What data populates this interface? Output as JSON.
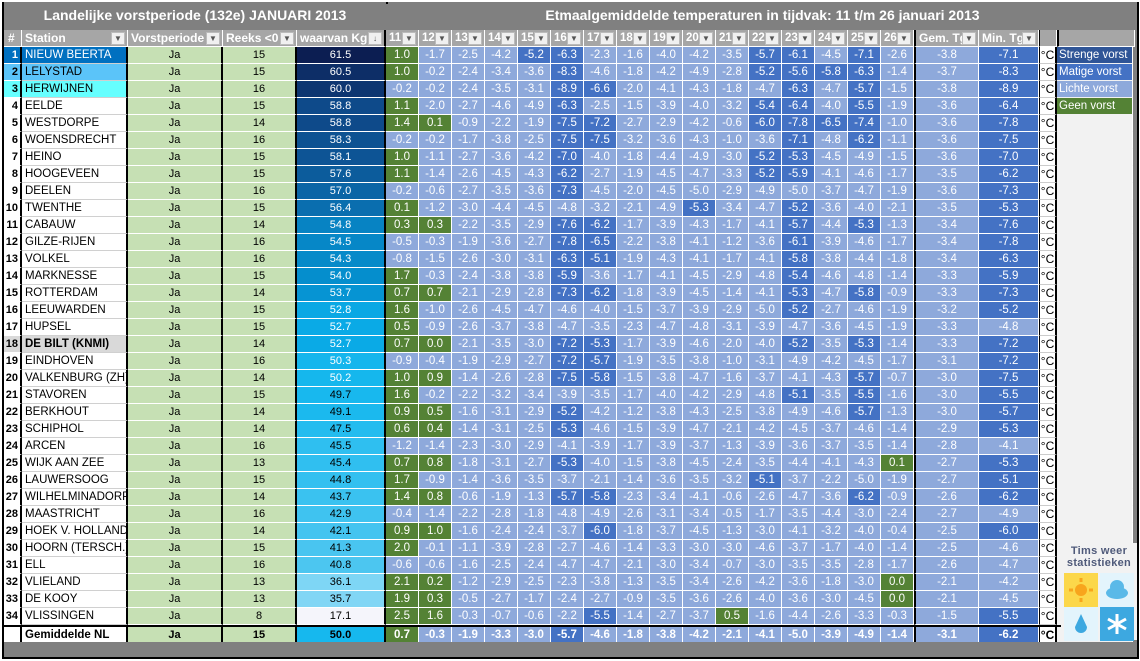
{
  "titles": {
    "left": "Landelijke vorstperiode (132e) JANUARI 2013",
    "right": "Etmaalgemiddelde temperaturen in tijdvak: 11 t/m 26 januari 2013"
  },
  "headers": {
    "num": "#",
    "station": "Station",
    "vorstperiode": "Vorstperiode",
    "reeks": "Reeks <0",
    "kg": "waarvan Kg",
    "days": [
      "11",
      "12",
      "13",
      "14",
      "15",
      "16",
      "17",
      "18",
      "19",
      "20",
      "21",
      "22",
      "23",
      "24",
      "25",
      "26"
    ],
    "gem": "Gem. Tg",
    "min": "Min. Tg"
  },
  "unit": "°C",
  "legend": [
    {
      "label": "Strenge vorst",
      "color": "#2f5597"
    },
    {
      "label": "Matige vorst",
      "color": "#4472c4"
    },
    {
      "label": "Lichte vorst",
      "color": "#8ea9db"
    },
    {
      "label": "Geen vorst",
      "color": "#548235"
    }
  ],
  "logo": {
    "text": "Tims weer statistieken"
  },
  "colors": {
    "light": "#8ea9db",
    "matige": "#4472c4",
    "geen": "#548235"
  },
  "rows": [
    {
      "n": "1",
      "station": "NIEUW BEERTA",
      "vp": "Ja",
      "reeks": "15",
      "kg": "61.5",
      "t": [
        "1.0",
        "-1.7",
        "-2.5",
        "-4.2",
        "-5.2",
        "-6.3",
        "-2.3",
        "-1.6",
        "-4.0",
        "-4.2",
        "-3.5",
        "-5.7",
        "-6.1",
        "-4.5",
        "-7.1",
        "-2.6"
      ],
      "gem": "-3.8",
      "min": "-7.1"
    },
    {
      "n": "2",
      "station": "LELYSTAD",
      "vp": "Ja",
      "reeks": "15",
      "kg": "60.5",
      "t": [
        "1.0",
        "-0.2",
        "-2.4",
        "-3.4",
        "-3.6",
        "-8.3",
        "-4.6",
        "-1.8",
        "-4.2",
        "-4.9",
        "-2.8",
        "-5.2",
        "-5.6",
        "-5.8",
        "-6.3",
        "-1.4"
      ],
      "gem": "-3.7",
      "min": "-8.3"
    },
    {
      "n": "3",
      "station": "HERWIJNEN",
      "vp": "Ja",
      "reeks": "16",
      "kg": "60.0",
      "t": [
        "-0.2",
        "-0.2",
        "-2.4",
        "-3.5",
        "-3.1",
        "-8.9",
        "-6.6",
        "-2.0",
        "-4.1",
        "-4.3",
        "-1.8",
        "-4.7",
        "-6.3",
        "-4.7",
        "-5.7",
        "-1.5"
      ],
      "gem": "-3.8",
      "min": "-8.9"
    },
    {
      "n": "4",
      "station": "EELDE",
      "vp": "Ja",
      "reeks": "15",
      "kg": "58.8",
      "t": [
        "1.1",
        "-2.0",
        "-2.7",
        "-4.6",
        "-4.9",
        "-6.3",
        "-2.5",
        "-1.5",
        "-3.9",
        "-4.0",
        "-3.2",
        "-5.4",
        "-6.4",
        "-4.0",
        "-5.5",
        "-1.9"
      ],
      "gem": "-3.6",
      "min": "-6.4"
    },
    {
      "n": "5",
      "station": "WESTDORPE",
      "vp": "Ja",
      "reeks": "14",
      "kg": "58.8",
      "t": [
        "1.4",
        "0.1",
        "-0.9",
        "-2.2",
        "-1.9",
        "-7.5",
        "-7.2",
        "-2.7",
        "-2.9",
        "-4.2",
        "-0.6",
        "-6.0",
        "-7.8",
        "-6.5",
        "-7.4",
        "-1.0"
      ],
      "gem": "-3.6",
      "min": "-7.8"
    },
    {
      "n": "6",
      "station": "WOENSDRECHT",
      "vp": "Ja",
      "reeks": "16",
      "kg": "58.3",
      "t": [
        "-0.2",
        "-0.2",
        "-1.7",
        "-3.8",
        "-2.5",
        "-7.5",
        "-7.5",
        "-3.2",
        "-3.6",
        "-4.3",
        "-1.0",
        "-3.6",
        "-7.1",
        "-4.8",
        "-6.2",
        "-1.1"
      ],
      "gem": "-3.6",
      "min": "-7.5"
    },
    {
      "n": "7",
      "station": "HEINO",
      "vp": "Ja",
      "reeks": "15",
      "kg": "58.1",
      "t": [
        "1.0",
        "-1.1",
        "-2.7",
        "-3.6",
        "-4.2",
        "-7.0",
        "-4.0",
        "-1.8",
        "-4.4",
        "-4.9",
        "-3.0",
        "-5.2",
        "-5.3",
        "-4.5",
        "-4.9",
        "-1.5"
      ],
      "gem": "-3.6",
      "min": "-7.0"
    },
    {
      "n": "8",
      "station": "HOOGEVEEN",
      "vp": "Ja",
      "reeks": "15",
      "kg": "57.6",
      "t": [
        "1.1",
        "-1.4",
        "-2.6",
        "-4.5",
        "-4.3",
        "-6.2",
        "-2.7",
        "-1.9",
        "-4.5",
        "-4.7",
        "-3.3",
        "-5.2",
        "-5.9",
        "-4.1",
        "-4.6",
        "-1.7"
      ],
      "gem": "-3.5",
      "min": "-6.2"
    },
    {
      "n": "9",
      "station": "DEELEN",
      "vp": "Ja",
      "reeks": "16",
      "kg": "57.0",
      "t": [
        "-0.2",
        "-0.6",
        "-2.7",
        "-3.5",
        "-3.6",
        "-7.3",
        "-4.5",
        "-2.0",
        "-4.5",
        "-5.0",
        "-2.9",
        "-4.9",
        "-5.0",
        "-3.7",
        "-4.7",
        "-1.9"
      ],
      "gem": "-3.6",
      "min": "-7.3"
    },
    {
      "n": "10",
      "station": "TWENTHE",
      "vp": "Ja",
      "reeks": "15",
      "kg": "56.4",
      "t": [
        "0.1",
        "-1.2",
        "-3.0",
        "-4.4",
        "-4.5",
        "-4.8",
        "-3.2",
        "-2.1",
        "-4.9",
        "-5.3",
        "-3.4",
        "-4.7",
        "-5.2",
        "-3.6",
        "-4.0",
        "-2.1"
      ],
      "gem": "-3.5",
      "min": "-5.3"
    },
    {
      "n": "11",
      "station": "CABAUW",
      "vp": "Ja",
      "reeks": "14",
      "kg": "54.8",
      "t": [
        "0.3",
        "0.3",
        "-2.2",
        "-3.5",
        "-2.9",
        "-7.6",
        "-6.2",
        "-1.7",
        "-3.9",
        "-4.3",
        "-1.7",
        "-4.1",
        "-5.7",
        "-4.4",
        "-5.3",
        "-1.3"
      ],
      "gem": "-3.4",
      "min": "-7.6"
    },
    {
      "n": "12",
      "station": "GILZE-RIJEN",
      "vp": "Ja",
      "reeks": "16",
      "kg": "54.5",
      "t": [
        "-0.5",
        "-0.3",
        "-1.9",
        "-3.6",
        "-2.7",
        "-7.8",
        "-6.5",
        "-2.2",
        "-3.8",
        "-4.1",
        "-1.2",
        "-3.6",
        "-6.1",
        "-3.9",
        "-4.6",
        "-1.7"
      ],
      "gem": "-3.4",
      "min": "-7.8"
    },
    {
      "n": "13",
      "station": "VOLKEL",
      "vp": "Ja",
      "reeks": "16",
      "kg": "54.3",
      "t": [
        "-0.8",
        "-1.5",
        "-2.6",
        "-3.0",
        "-3.1",
        "-6.3",
        "-5.1",
        "-1.9",
        "-4.3",
        "-4.1",
        "-1.7",
        "-4.1",
        "-5.8",
        "-3.8",
        "-4.4",
        "-1.8"
      ],
      "gem": "-3.4",
      "min": "-6.3"
    },
    {
      "n": "14",
      "station": "MARKNESSE",
      "vp": "Ja",
      "reeks": "15",
      "kg": "54.0",
      "t": [
        "1.7",
        "-0.3",
        "-2.4",
        "-3.8",
        "-3.8",
        "-5.9",
        "-3.6",
        "-1.7",
        "-4.1",
        "-4.5",
        "-2.9",
        "-4.8",
        "-5.4",
        "-4.6",
        "-4.8",
        "-1.4"
      ],
      "gem": "-3.3",
      "min": "-5.9"
    },
    {
      "n": "15",
      "station": "ROTTERDAM",
      "vp": "Ja",
      "reeks": "14",
      "kg": "53.7",
      "t": [
        "0.7",
        "0.7",
        "-2.1",
        "-2.9",
        "-2.8",
        "-7.3",
        "-6.2",
        "-1.8",
        "-3.9",
        "-4.5",
        "-1.4",
        "-4.1",
        "-5.3",
        "-4.7",
        "-5.8",
        "-0.9"
      ],
      "gem": "-3.3",
      "min": "-7.3"
    },
    {
      "n": "16",
      "station": "LEEUWARDEN",
      "vp": "Ja",
      "reeks": "15",
      "kg": "52.8",
      "t": [
        "1.6",
        "-1.0",
        "-2.6",
        "-4.5",
        "-4.7",
        "-4.6",
        "-4.0",
        "-1.5",
        "-3.7",
        "-3.9",
        "-2.9",
        "-5.0",
        "-5.2",
        "-2.7",
        "-4.6",
        "-1.9"
      ],
      "gem": "-3.2",
      "min": "-5.2"
    },
    {
      "n": "17",
      "station": "HUPSEL",
      "vp": "Ja",
      "reeks": "15",
      "kg": "52.7",
      "t": [
        "0.5",
        "-0.9",
        "-2.6",
        "-3.7",
        "-3.8",
        "-4.7",
        "-3.5",
        "-2.3",
        "-4.7",
        "-4.8",
        "-3.1",
        "-3.9",
        "-4.7",
        "-3.6",
        "-4.5",
        "-1.9"
      ],
      "gem": "-3.3",
      "min": "-4.8"
    },
    {
      "n": "18",
      "station": "DE BILT (KNMI)",
      "vp": "Ja",
      "reeks": "14",
      "kg": "52.7",
      "t": [
        "0.7",
        "0.0",
        "-2.1",
        "-3.5",
        "-3.0",
        "-7.2",
        "-5.3",
        "-1.7",
        "-3.9",
        "-4.6",
        "-2.0",
        "-4.0",
        "-5.2",
        "-3.5",
        "-5.3",
        "-1.4"
      ],
      "gem": "-3.3",
      "min": "-7.2"
    },
    {
      "n": "19",
      "station": "EINDHOVEN",
      "vp": "Ja",
      "reeks": "16",
      "kg": "50.3",
      "t": [
        "-0.9",
        "-0.4",
        "-1.9",
        "-2.9",
        "-2.7",
        "-7.2",
        "-5.7",
        "-1.9",
        "-3.5",
        "-3.8",
        "-1.0",
        "-3.1",
        "-4.9",
        "-4.2",
        "-4.5",
        "-1.7"
      ],
      "gem": "-3.1",
      "min": "-7.2"
    },
    {
      "n": "20",
      "station": "VALKENBURG (ZH)",
      "vp": "Ja",
      "reeks": "14",
      "kg": "50.2",
      "t": [
        "1.0",
        "0.9",
        "-1.4",
        "-2.6",
        "-2.8",
        "-7.5",
        "-5.8",
        "-1.5",
        "-3.8",
        "-4.7",
        "-1.6",
        "-3.7",
        "-4.1",
        "-4.3",
        "-5.7",
        "-0.7"
      ],
      "gem": "-3.0",
      "min": "-7.5"
    },
    {
      "n": "21",
      "station": "STAVOREN",
      "vp": "Ja",
      "reeks": "15",
      "kg": "49.7",
      "t": [
        "1.6",
        "-0.2",
        "-2.2",
        "-3.2",
        "-3.4",
        "-3.9",
        "-3.5",
        "-1.7",
        "-4.0",
        "-4.2",
        "-2.9",
        "-4.8",
        "-5.1",
        "-3.5",
        "-5.5",
        "-1.6"
      ],
      "gem": "-3.0",
      "min": "-5.5"
    },
    {
      "n": "22",
      "station": "BERKHOUT",
      "vp": "Ja",
      "reeks": "14",
      "kg": "49.1",
      "t": [
        "0.9",
        "0.5",
        "-1.6",
        "-3.1",
        "-2.9",
        "-5.2",
        "-4.2",
        "-1.2",
        "-3.8",
        "-4.3",
        "-2.5",
        "-3.8",
        "-4.9",
        "-4.6",
        "-5.7",
        "-1.3"
      ],
      "gem": "-3.0",
      "min": "-5.7"
    },
    {
      "n": "23",
      "station": "SCHIPHOL",
      "vp": "Ja",
      "reeks": "14",
      "kg": "47.5",
      "t": [
        "0.6",
        "0.4",
        "-1.4",
        "-3.1",
        "-2.5",
        "-5.3",
        "-4.6",
        "-1.5",
        "-3.9",
        "-4.7",
        "-2.1",
        "-4.2",
        "-4.5",
        "-3.7",
        "-4.6",
        "-1.4"
      ],
      "gem": "-2.9",
      "min": "-5.3"
    },
    {
      "n": "24",
      "station": "ARCEN",
      "vp": "Ja",
      "reeks": "16",
      "kg": "45.5",
      "t": [
        "-1.2",
        "-1.4",
        "-2.3",
        "-3.0",
        "-2.9",
        "-4.1",
        "-3.9",
        "-1.7",
        "-3.9",
        "-3.7",
        "-1.3",
        "-3.9",
        "-3.6",
        "-3.7",
        "-3.5",
        "-1.4"
      ],
      "gem": "-2.8",
      "min": "-4.1"
    },
    {
      "n": "25",
      "station": "WIJK AAN ZEE",
      "vp": "Ja",
      "reeks": "13",
      "kg": "45.4",
      "t": [
        "0.7",
        "0.8",
        "-1.8",
        "-3.1",
        "-2.7",
        "-5.3",
        "-4.0",
        "-1.5",
        "-3.8",
        "-4.5",
        "-2.4",
        "-3.5",
        "-4.4",
        "-4.1",
        "-4.3",
        "0.1"
      ],
      "gem": "-2.7",
      "min": "-5.3"
    },
    {
      "n": "26",
      "station": "LAUWERSOOG",
      "vp": "Ja",
      "reeks": "15",
      "kg": "44.8",
      "t": [
        "1.7",
        "-0.9",
        "-1.4",
        "-3.6",
        "-3.5",
        "-3.7",
        "-2.1",
        "-1.4",
        "-3.6",
        "-3.5",
        "-3.2",
        "-5.1",
        "-3.7",
        "-2.2",
        "-5.0",
        "-1.9"
      ],
      "gem": "-2.7",
      "min": "-5.1"
    },
    {
      "n": "27",
      "station": "WILHELMINADORP",
      "vp": "Ja",
      "reeks": "14",
      "kg": "43.7",
      "t": [
        "1.4",
        "0.8",
        "-0.6",
        "-1.9",
        "-1.3",
        "-5.7",
        "-5.8",
        "-2.3",
        "-3.4",
        "-4.1",
        "-0.6",
        "-2.6",
        "-4.7",
        "-3.6",
        "-6.2",
        "-0.9"
      ],
      "gem": "-2.6",
      "min": "-6.2"
    },
    {
      "n": "28",
      "station": "MAASTRICHT",
      "vp": "Ja",
      "reeks": "16",
      "kg": "42.9",
      "t": [
        "-0.4",
        "-1.4",
        "-2.2",
        "-2.8",
        "-1.8",
        "-4.8",
        "-4.9",
        "-2.6",
        "-3.1",
        "-3.4",
        "-0.5",
        "-1.7",
        "-3.5",
        "-4.4",
        "-3.0",
        "-2.4"
      ],
      "gem": "-2.7",
      "min": "-4.9"
    },
    {
      "n": "29",
      "station": "HOEK V. HOLLAND",
      "vp": "Ja",
      "reeks": "14",
      "kg": "42.1",
      "t": [
        "0.9",
        "1.0",
        "-1.6",
        "-2.4",
        "-2.4",
        "-3.7",
        "-6.0",
        "-1.8",
        "-3.7",
        "-4.5",
        "-1.3",
        "-3.0",
        "-4.1",
        "-3.2",
        "-4.0",
        "-0.4"
      ],
      "gem": "-2.5",
      "min": "-6.0"
    },
    {
      "n": "30",
      "station": "HOORN (TERSCH.)",
      "vp": "Ja",
      "reeks": "15",
      "kg": "41.3",
      "t": [
        "2.0",
        "-0.1",
        "-1.1",
        "-3.9",
        "-2.8",
        "-2.7",
        "-4.6",
        "-1.4",
        "-3.3",
        "-3.0",
        "-3.0",
        "-4.6",
        "-3.7",
        "-1.7",
        "-4.0",
        "-1.4"
      ],
      "gem": "-2.5",
      "min": "-4.6"
    },
    {
      "n": "31",
      "station": "ELL",
      "vp": "Ja",
      "reeks": "16",
      "kg": "40.8",
      "t": [
        "-0.6",
        "-0.6",
        "-1.6",
        "-2.5",
        "-2.4",
        "-4.7",
        "-4.7",
        "-2.1",
        "-3.0",
        "-3.4",
        "-0.7",
        "-3.0",
        "-3.5",
        "-3.5",
        "-2.8",
        "-1.7"
      ],
      "gem": "-2.6",
      "min": "-4.7"
    },
    {
      "n": "32",
      "station": "VLIELAND",
      "vp": "Ja",
      "reeks": "13",
      "kg": "36.1",
      "t": [
        "2.1",
        "0.2",
        "-1.2",
        "-2.9",
        "-2.5",
        "-2.3",
        "-3.8",
        "-1.3",
        "-3.5",
        "-3.4",
        "-2.6",
        "-4.2",
        "-3.6",
        "-1.8",
        "-3.0",
        "0.0"
      ],
      "gem": "-2.1",
      "min": "-4.2"
    },
    {
      "n": "33",
      "station": "DE KOOY",
      "vp": "Ja",
      "reeks": "13",
      "kg": "35.7",
      "t": [
        "1.9",
        "0.3",
        "-0.5",
        "-2.7",
        "-1.7",
        "-2.4",
        "-2.7",
        "-0.9",
        "-3.5",
        "-3.6",
        "-2.6",
        "-4.0",
        "-3.6",
        "-3.0",
        "-4.5",
        "0.0"
      ],
      "gem": "-2.1",
      "min": "-4.5"
    },
    {
      "n": "34",
      "station": "VLISSINGEN",
      "vp": "Ja",
      "reeks": "8",
      "kg": "17.1",
      "t": [
        "2.5",
        "1.6",
        "-0.3",
        "-0.7",
        "-0.6",
        "-2.2",
        "-5.5",
        "-1.4",
        "-2.7",
        "-3.7",
        "0.5",
        "-1.6",
        "-4.4",
        "-2.6",
        "-3.3",
        "-0.3"
      ],
      "gem": "-1.5",
      "min": "-5.5"
    }
  ],
  "average": {
    "station": "Gemiddelde NL",
    "vp": "Ja",
    "reeks": "15",
    "kg": "50.0",
    "t": [
      "0.7",
      "-0.3",
      "-1.9",
      "-3.3",
      "-3.0",
      "-5.7",
      "-4.6",
      "-1.8",
      "-3.8",
      "-4.2",
      "-2.1",
      "-4.1",
      "-5.0",
      "-3.9",
      "-4.9",
      "-1.4"
    ],
    "gem": "-3.1",
    "min": "-6.2"
  }
}
